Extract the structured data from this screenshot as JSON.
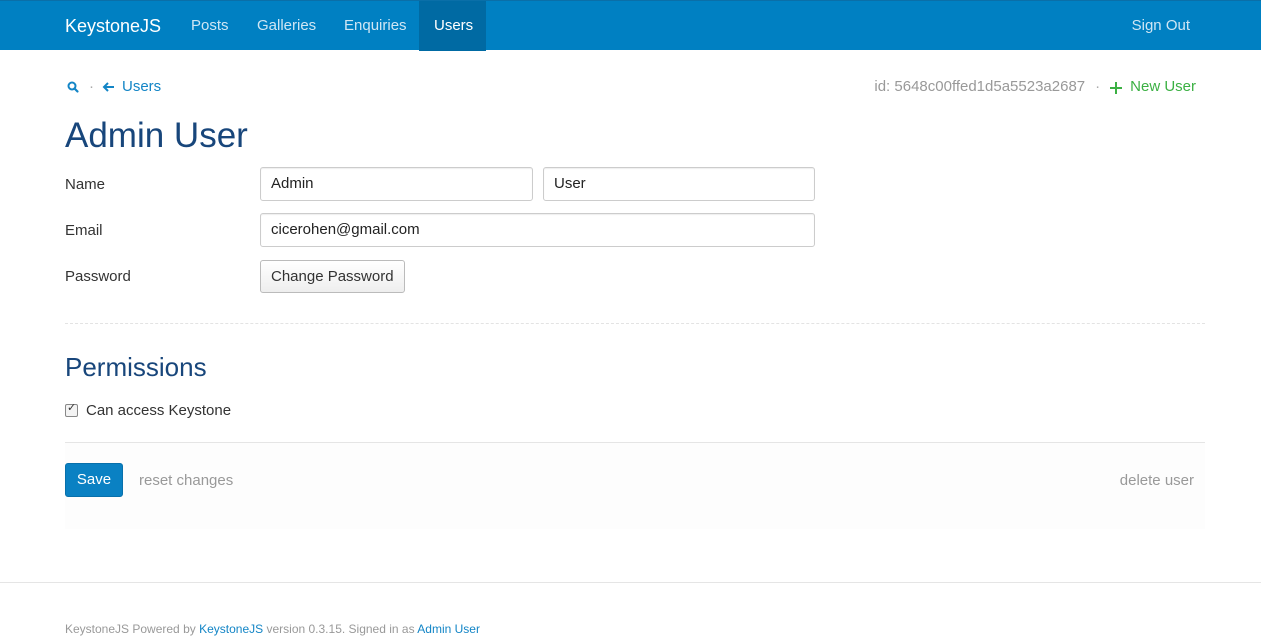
{
  "navbar": {
    "brand": "KeystoneJS",
    "items": [
      {
        "label": "Posts"
      },
      {
        "label": "Galleries"
      },
      {
        "label": "Enquiries"
      },
      {
        "label": "Users"
      }
    ],
    "active": "Users",
    "sign_out": "Sign Out"
  },
  "toolbar": {
    "search_icon": "search-icon",
    "back_icon": "arrow-left-icon",
    "back_label": "Users",
    "id_text": "id: 5648c00ffed1d5a5523a2687",
    "new_icon": "plus-icon",
    "new_label": "New User",
    "separator": "·"
  },
  "form": {
    "title": "Admin User",
    "name_label": "Name",
    "first_name": "Admin",
    "last_name": "User",
    "email_label": "Email",
    "email": "cicerohen@gmail.com",
    "password_label": "Password",
    "change_password": "Change Password"
  },
  "permissions": {
    "title": "Permissions",
    "can_access_label": "Can access Keystone",
    "can_access_checked": true
  },
  "actions": {
    "save": "Save",
    "reset": "reset changes",
    "delete": "delete user"
  },
  "footer": {
    "prefix": "KeystoneJS Powered by",
    "powered_link": "KeystoneJS",
    "version_text": "version 0.3.15. Signed in as",
    "user_link": "Admin User"
  },
  "colors": {
    "navbar": "#0080c2",
    "accent": "#1385c6",
    "title": "#18467b",
    "new": "#3bb043"
  }
}
